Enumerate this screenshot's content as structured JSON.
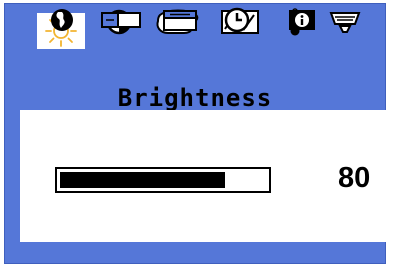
{
  "menu": {
    "title": "Brightness",
    "icons_row1": [
      "sun-icon",
      "contrast-icon",
      "color-palette-icon",
      "geometry-wave-icon",
      "thermometer-icon",
      "degauss-icon"
    ],
    "icons_row2": [
      "language-globe-icon",
      "horizontal-size-icon",
      "vertical-size-icon",
      "clock-icon",
      "info-icon"
    ],
    "selected_icon": "sun-icon"
  },
  "adjust": {
    "value": "80",
    "level": 0.8
  },
  "colors": {
    "background": "#5577d8",
    "panel": "#ffffff",
    "bar_fill": "#000000",
    "selected_icon_bg": "#ffffff",
    "sun": "#f2b430"
  }
}
